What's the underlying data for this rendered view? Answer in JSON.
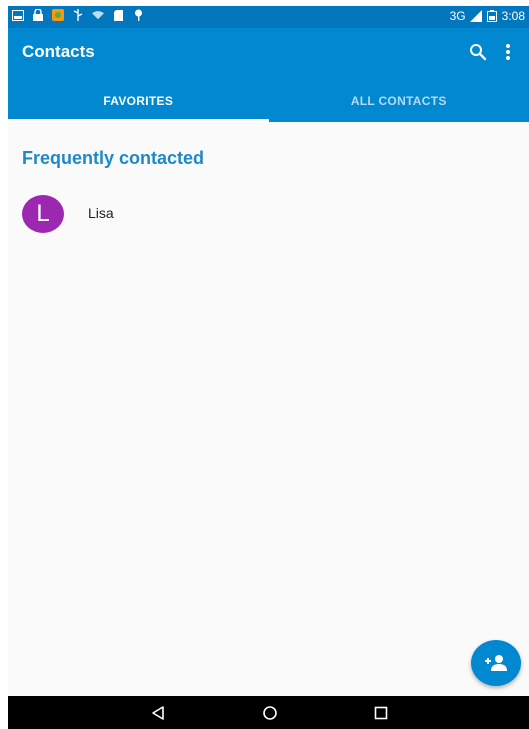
{
  "status_bar": {
    "network": "3G",
    "time": "3:08",
    "icons": [
      "gallery-icon",
      "lock-icon",
      "app-icon",
      "usb-icon",
      "wifi-icon",
      "sd-card-icon",
      "pin-icon",
      "signal-icon",
      "battery-icon"
    ]
  },
  "app_bar": {
    "title": "Contacts",
    "actions": [
      "search-icon",
      "more-vert-icon"
    ]
  },
  "tabs": [
    {
      "label": "FAVORITES",
      "active": true
    },
    {
      "label": "ALL CONTACTS",
      "active": false
    }
  ],
  "favorites": {
    "section_title": "Frequently contacted",
    "contacts": [
      {
        "initial": "L",
        "name": "Lisa",
        "avatar_color": "#9c27b0"
      }
    ]
  },
  "fab": {
    "icon": "add-person-icon"
  },
  "nav_bar": {
    "buttons": [
      "back-icon",
      "home-icon",
      "recents-icon"
    ]
  },
  "colors": {
    "status_bar": "#0277bd",
    "primary": "#0288d1",
    "accent_text": "#1e88c8",
    "avatar": "#9c27b0",
    "background": "#fafafa"
  }
}
